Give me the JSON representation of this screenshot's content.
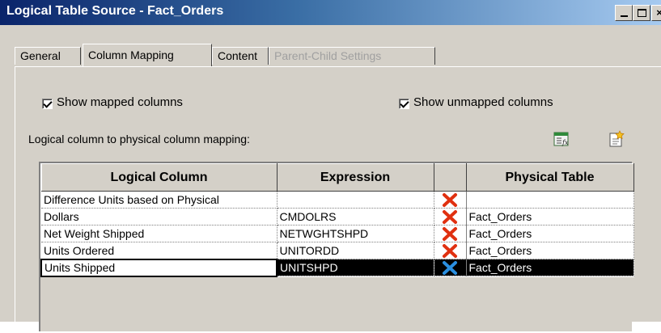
{
  "window": {
    "title": "Logical Table Source - Fact_Orders"
  },
  "tabs": [
    {
      "label": "General",
      "state": "normal"
    },
    {
      "label": "Column Mapping",
      "state": "active"
    },
    {
      "label": "Content",
      "state": "normal"
    },
    {
      "label": "Parent-Child Settings",
      "state": "disabled"
    }
  ],
  "options": {
    "show_mapped": {
      "label": "Show mapped columns",
      "checked": true
    },
    "show_unmapped": {
      "label": "Show unmapped columns",
      "checked": true
    }
  },
  "mapping_label": "Logical column to physical column mapping:",
  "toolbar_icons": [
    "expression-builder-icon",
    "new-item-icon"
  ],
  "grid": {
    "headers": [
      "Logical Column",
      "Expression",
      "",
      "Physical Table"
    ],
    "rows": [
      {
        "logical": "Difference Units based on Physical",
        "expression": "",
        "status_icon": "red-x-icon",
        "physical": ""
      },
      {
        "logical": "Dollars",
        "expression": "CMDOLRS",
        "status_icon": "red-x-icon",
        "physical": "Fact_Orders"
      },
      {
        "logical": "Net Weight Shipped",
        "expression": "NETWGHTSHPD",
        "status_icon": "red-x-icon",
        "physical": "Fact_Orders"
      },
      {
        "logical": "Units Ordered",
        "expression": "UNITORDD",
        "status_icon": "red-x-icon",
        "physical": "Fact_Orders"
      },
      {
        "logical": "Units Shipped",
        "expression": "UNITSHPD",
        "status_icon": "blue-x-icon",
        "physical": "Fact_Orders",
        "selected": true
      }
    ]
  },
  "colors": {
    "titlebar_start": "#0a246a",
    "titlebar_end": "#a6caf0",
    "dialog_face": "#d4d0c8",
    "x_red": "#e03010",
    "x_blue": "#2a8fe0"
  }
}
